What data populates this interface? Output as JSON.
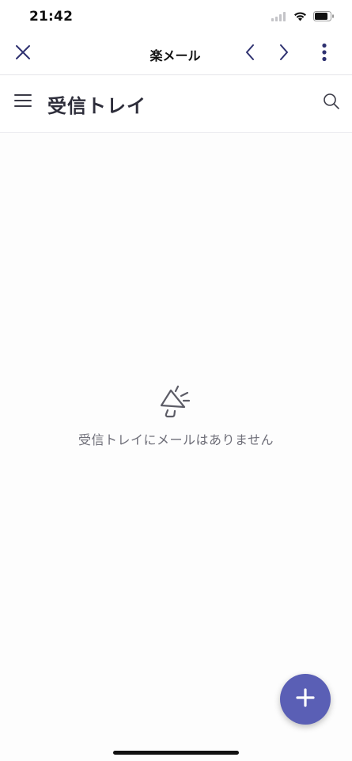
{
  "status_bar": {
    "time": "21:42",
    "icons": [
      "cellular-signal-icon",
      "wifi-icon",
      "battery-icon"
    ]
  },
  "app_bar": {
    "title": "楽メール",
    "icons": [
      "close-icon",
      "chevron-left-icon",
      "chevron-right-icon",
      "more-vertical-icon"
    ]
  },
  "folder_bar": {
    "title": "受信トレイ",
    "icons": [
      "menu-icon",
      "search-icon"
    ]
  },
  "empty_state": {
    "icon": "megaphone-icon",
    "message": "受信トレイにメールはありません"
  },
  "fab": {
    "icon": "plus-icon"
  },
  "colors": {
    "accent": "#5a5fb5",
    "icon_navy": "#2e3170",
    "empty_text": "#6e6e78"
  }
}
